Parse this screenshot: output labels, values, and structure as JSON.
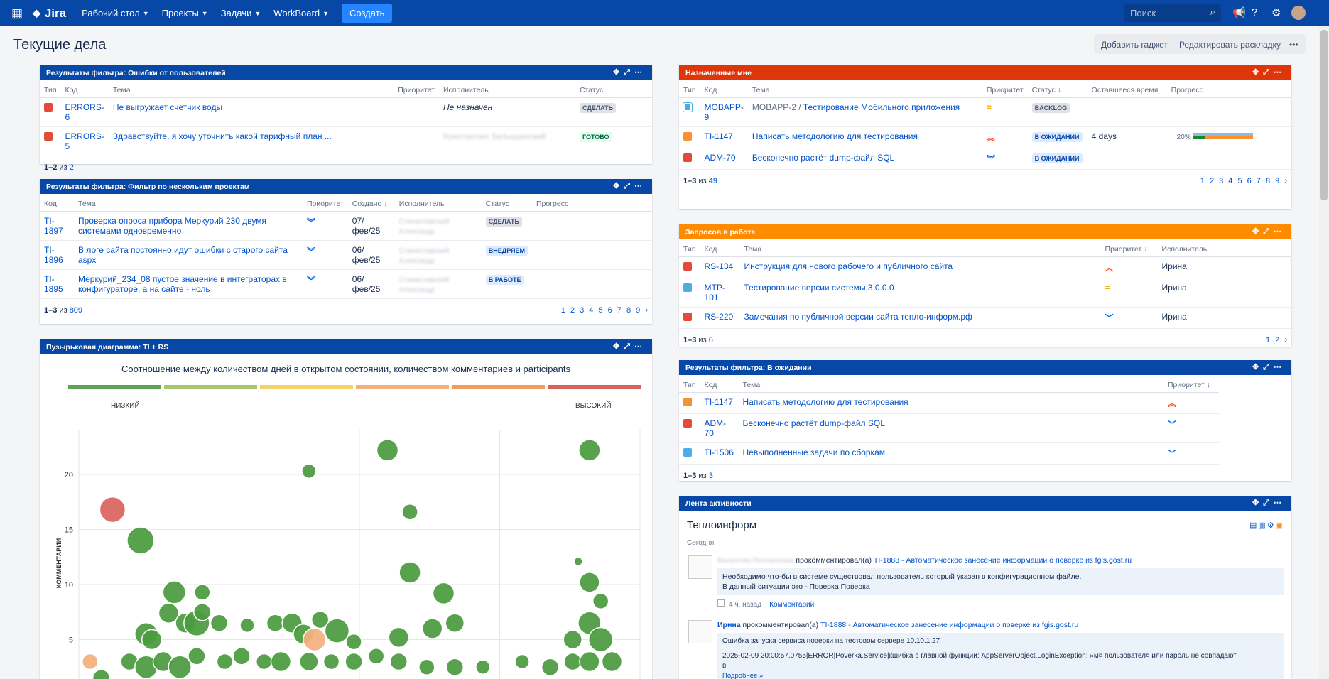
{
  "topbar": {
    "logo": "Jira",
    "nav": [
      "Рабочий стол",
      "Проекты",
      "Задачи",
      "WorkBoard"
    ],
    "create": "Создать",
    "search_placeholder": "Поиск"
  },
  "page": {
    "title": "Текущие дела",
    "add_gadget": "Добавить гаджет",
    "edit_layout": "Редактировать раскладку",
    "more": "•••"
  },
  "g1": {
    "title": "Результаты фильтра: Ошибки от пользователей",
    "cols": [
      "Тип",
      "Код",
      "Тема",
      "Приоритет",
      "Исполнитель",
      "Статус"
    ],
    "rows": [
      {
        "key": "ERRORS-6",
        "summary": "Не выгружает счетчик воды",
        "assignee": "Не назначен",
        "status": "СДЕЛАТЬ"
      },
      {
        "key": "ERRORS-5",
        "summary": "Здравствуйте, я хочу уточнить какой тарифный план ...",
        "assignee": "Константин Залышанский",
        "status": "ГОТОВО"
      }
    ],
    "count": "1–2",
    "of": "из",
    "total": "2"
  },
  "g2": {
    "title": "Результаты фильтра: Фильтр по нескольким проектам",
    "cols": [
      "Код",
      "Тема",
      "Приоритет",
      "Создано",
      "Исполнитель",
      "Статус",
      "Прогресс"
    ],
    "rows": [
      {
        "key": "TI-1897",
        "summary": "Проверка опроса прибора Меркурий 230 двумя системами одновременно",
        "created": "07/фев/25",
        "assignee": "Станиславский Александр",
        "status": "СДЕЛАТЬ"
      },
      {
        "key": "TI-1896",
        "summary": "В логе сайта постоянно идут ошибки с старого сайта aspx",
        "created": "06/фев/25",
        "assignee": "Станиславский Александр",
        "status": "ВНЕДРЯЕМ"
      },
      {
        "key": "TI-1895",
        "summary": "Меркурий_234_08 пустое значение в интеграторах в конфигураторе, а на сайте - ноль",
        "created": "06/фев/25",
        "assignee": "Станиславский Александр",
        "status": "В РАБОТЕ"
      }
    ],
    "count": "1–3",
    "of": "из",
    "total": "809",
    "pages": "1 2 3 4 5 6 7 8 9 ›"
  },
  "g3": {
    "title": "Пузырьковая диаграмма: TI + RS",
    "chart_title": "Соотношение между количеством дней в открытом состоянии, количеством комментариев и participants",
    "low": "НИЗКИЙ",
    "high": "ВЫСОКИЙ",
    "ylabel": "КОММЕНТАРИИ"
  },
  "chart_data": {
    "type": "scatter",
    "title": "Соотношение между количеством дней в открытом состоянии, количеством комментариев и participants",
    "ylabel": "КОММЕНТАРИИ",
    "yticks": [
      5,
      10,
      15,
      20
    ],
    "ylim": [
      0,
      24
    ],
    "xlim": [
      0,
      100
    ],
    "legend": [
      "НИЗКИЙ",
      "ВЫСОКИЙ"
    ],
    "legend_colors": [
      "#5aa454",
      "#a8c76a",
      "#f2d06b",
      "#f3b07d",
      "#f09d5a",
      "#d9635c"
    ],
    "grid": true,
    "points": [
      {
        "x": 6,
        "y": 16.8,
        "r": 18,
        "c": "#d9635c"
      },
      {
        "x": 11,
        "y": 14,
        "r": 19,
        "c": "#4a9a3e"
      },
      {
        "x": 41,
        "y": 20.3,
        "r": 10,
        "c": "#4a9a3e"
      },
      {
        "x": 55,
        "y": 22.2,
        "r": 15,
        "c": "#4a9a3e"
      },
      {
        "x": 59,
        "y": 16.6,
        "r": 11,
        "c": "#4a9a3e"
      },
      {
        "x": 59,
        "y": 11.1,
        "r": 15,
        "c": "#4a9a3e"
      },
      {
        "x": 91,
        "y": 22.2,
        "r": 15,
        "c": "#4a9a3e"
      },
      {
        "x": 89,
        "y": 12.1,
        "r": 6,
        "c": "#4a9a3e"
      },
      {
        "x": 91,
        "y": 10.2,
        "r": 14,
        "c": "#4a9a3e"
      },
      {
        "x": 17,
        "y": 9.3,
        "r": 16,
        "c": "#4a9a3e"
      },
      {
        "x": 22,
        "y": 9.3,
        "r": 11,
        "c": "#4a9a3e"
      },
      {
        "x": 65,
        "y": 9.2,
        "r": 15,
        "c": "#4a9a3e"
      },
      {
        "x": 12,
        "y": 5.5,
        "r": 16,
        "c": "#4a9a3e"
      },
      {
        "x": 13,
        "y": 5,
        "r": 14,
        "c": "#4a9a3e"
      },
      {
        "x": 16,
        "y": 7.4,
        "r": 14,
        "c": "#4a9a3e"
      },
      {
        "x": 19,
        "y": 6.5,
        "r": 14,
        "c": "#4a9a3e"
      },
      {
        "x": 21,
        "y": 6.5,
        "r": 18,
        "c": "#4a9a3e"
      },
      {
        "x": 22,
        "y": 7.5,
        "r": 12,
        "c": "#4a9a3e"
      },
      {
        "x": 25,
        "y": 6.5,
        "r": 12,
        "c": "#4a9a3e"
      },
      {
        "x": 30,
        "y": 6.3,
        "r": 10,
        "c": "#4a9a3e"
      },
      {
        "x": 35,
        "y": 6.5,
        "r": 12,
        "c": "#4a9a3e"
      },
      {
        "x": 38,
        "y": 6.5,
        "r": 14,
        "c": "#4a9a3e"
      },
      {
        "x": 40,
        "y": 5.5,
        "r": 14,
        "c": "#4a9a3e"
      },
      {
        "x": 42,
        "y": 5,
        "r": 16,
        "c": "#f3b07d"
      },
      {
        "x": 43,
        "y": 6.8,
        "r": 12,
        "c": "#4a9a3e"
      },
      {
        "x": 46,
        "y": 5.8,
        "r": 17,
        "c": "#4a9a3e"
      },
      {
        "x": 49,
        "y": 4.8,
        "r": 11,
        "c": "#4a9a3e"
      },
      {
        "x": 57,
        "y": 5.2,
        "r": 14,
        "c": "#4a9a3e"
      },
      {
        "x": 63,
        "y": 6,
        "r": 14,
        "c": "#4a9a3e"
      },
      {
        "x": 67,
        "y": 6.5,
        "r": 13,
        "c": "#4a9a3e"
      },
      {
        "x": 88,
        "y": 5,
        "r": 13,
        "c": "#4a9a3e"
      },
      {
        "x": 91,
        "y": 6.5,
        "r": 16,
        "c": "#4a9a3e"
      },
      {
        "x": 93,
        "y": 8.5,
        "r": 11,
        "c": "#4a9a3e"
      },
      {
        "x": 93,
        "y": 5,
        "r": 17,
        "c": "#4a9a3e"
      },
      {
        "x": 2,
        "y": 3,
        "r": 11,
        "c": "#f3b07d"
      },
      {
        "x": 4,
        "y": 1.5,
        "r": 12,
        "c": "#4a9a3e"
      },
      {
        "x": 9,
        "y": 3,
        "r": 12,
        "c": "#4a9a3e"
      },
      {
        "x": 12,
        "y": 2.5,
        "r": 16,
        "c": "#4a9a3e"
      },
      {
        "x": 15,
        "y": 3,
        "r": 14,
        "c": "#4a9a3e"
      },
      {
        "x": 18,
        "y": 2.5,
        "r": 16,
        "c": "#4a9a3e"
      },
      {
        "x": 21,
        "y": 3.5,
        "r": 12,
        "c": "#4a9a3e"
      },
      {
        "x": 26,
        "y": 3,
        "r": 11,
        "c": "#4a9a3e"
      },
      {
        "x": 29,
        "y": 3.5,
        "r": 12,
        "c": "#4a9a3e"
      },
      {
        "x": 33,
        "y": 3,
        "r": 11,
        "c": "#4a9a3e"
      },
      {
        "x": 36,
        "y": 3,
        "r": 14,
        "c": "#4a9a3e"
      },
      {
        "x": 41,
        "y": 3,
        "r": 13,
        "c": "#4a9a3e"
      },
      {
        "x": 45,
        "y": 3,
        "r": 11,
        "c": "#4a9a3e"
      },
      {
        "x": 49,
        "y": 3,
        "r": 12,
        "c": "#4a9a3e"
      },
      {
        "x": 53,
        "y": 3.5,
        "r": 11,
        "c": "#4a9a3e"
      },
      {
        "x": 57,
        "y": 3,
        "r": 12,
        "c": "#4a9a3e"
      },
      {
        "x": 62,
        "y": 2.5,
        "r": 11,
        "c": "#4a9a3e"
      },
      {
        "x": 67,
        "y": 2.5,
        "r": 12,
        "c": "#4a9a3e"
      },
      {
        "x": 72,
        "y": 2.5,
        "r": 10,
        "c": "#4a9a3e"
      },
      {
        "x": 79,
        "y": 3,
        "r": 10,
        "c": "#4a9a3e"
      },
      {
        "x": 84,
        "y": 2.5,
        "r": 12,
        "c": "#4a9a3e"
      },
      {
        "x": 88,
        "y": 3,
        "r": 12,
        "c": "#4a9a3e"
      },
      {
        "x": 91,
        "y": 3,
        "r": 14,
        "c": "#4a9a3e"
      },
      {
        "x": 95,
        "y": 3,
        "r": 14,
        "c": "#4a9a3e"
      }
    ]
  },
  "g4": {
    "title": "Назначенные мне",
    "cols": [
      "Тип",
      "Код",
      "Тема",
      "Приоритет",
      "Статус",
      "Оставшееся время",
      "Прогресс"
    ],
    "rows": [
      {
        "key": "MOBAPP-9",
        "parent": "MOBAPP-2 /",
        "summary": "Тестирование Мобильного приложения",
        "status": "BACKLOG",
        "remaining": ""
      },
      {
        "key": "TI-1147",
        "parent": "",
        "summary": "Написать методологию для тестирования",
        "status": "В ОЖИДАНИИ",
        "remaining": "4 days",
        "progress_label": "20%",
        "progress": 0.2
      },
      {
        "key": "ADM-70",
        "parent": "",
        "summary": "Бесконечно растёт dump-файл SQL",
        "status": "В ОЖИДАНИИ",
        "remaining": ""
      }
    ],
    "count": "1–3",
    "of": "из",
    "total": "49",
    "pages": "1 2 3 4 5 6 7 8 9 ›"
  },
  "g5": {
    "title": "Запросов в работе",
    "cols": [
      "Тип",
      "Код",
      "Тема",
      "Приоритет",
      "Исполнитель"
    ],
    "rows": [
      {
        "key": "RS-134",
        "summary": "Инструкция для нового рабочего и публичного сайта",
        "assignee": "Ирина"
      },
      {
        "key": "MTP-101",
        "summary": "Тестирование версии системы 3.0.0.0",
        "assignee": "Ирина"
      },
      {
        "key": "RS-220",
        "summary": "Замечания по публичной версии сайта тепло-информ.рф",
        "assignee": "Ирина"
      }
    ],
    "count": "1–3",
    "of": "из",
    "total": "6",
    "pages": "1 2 ›"
  },
  "g6": {
    "title": "Результаты фильтра: В ожидании",
    "cols": [
      "Тип",
      "Код",
      "Тема",
      "Приоритет"
    ],
    "rows": [
      {
        "key": "TI-1147",
        "summary": "Написать методологию для тестирования"
      },
      {
        "key": "ADM-70",
        "summary": "Бесконечно растёт dump-файл SQL"
      },
      {
        "key": "TI-1506",
        "summary": "Невыполненные задачи по сборкам"
      }
    ],
    "count": "1–3",
    "of": "из",
    "total": "3"
  },
  "g7": {
    "title": "Лента активности",
    "heading": "Теплоинформ",
    "today": "Сегодня",
    "e1_user": "Валентин Реплинская",
    "e1_action": "прокомментировал(а)",
    "e1_link": "TI-1888 - Автоматическое занесение информации о поверке из fgis.gost.ru",
    "e1_l1": "Необходимо что-бы в системе существовал пользователь который указан в конфигурационном файле.",
    "e1_l2": "В данный ситуации это - Поверка Поверка",
    "e1_time": "4 ч. назад",
    "e1_comment": "Комментарий",
    "e2_user": "Ирина",
    "e2_action": "прокомментировал(а)",
    "e2_link": "TI-1888 - Автоматическое занесение информации о поверке из fgis.gost.ru",
    "e2_l1": "Ошибка запуска сервиса поверки на тестовом сервере 10.10.1.27",
    "e2_l2": "2025-02-09 20:00:57.0755|ERROR|Poverka.Service|ќшибка в главной функции: AppServerObject.LoginException: »м¤ пользовател¤ или пароль не совпадают",
    "e2_l3": "в",
    "e2_more": "Подробнее »"
  },
  "colors": {
    "blue": "#0747a6",
    "red": "#de350b",
    "orange": "#ff8b00"
  }
}
